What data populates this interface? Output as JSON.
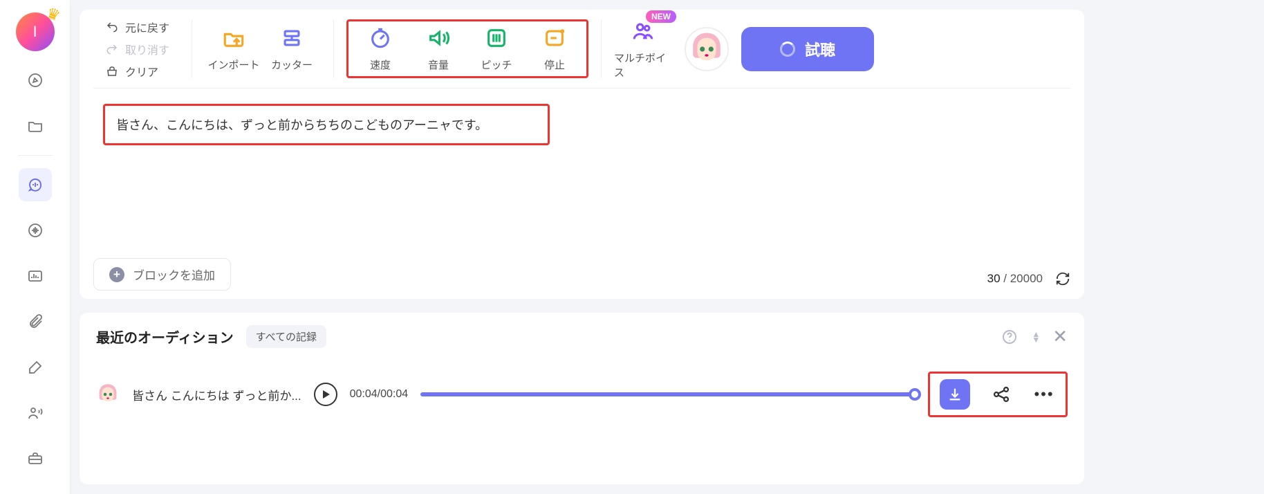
{
  "user": {
    "initial": "I"
  },
  "sidebar": {
    "activeIndex": 2
  },
  "toolbar": {
    "undo": "元に戻す",
    "redo": "取り消す",
    "clear": "クリア",
    "import": "インポート",
    "cutter": "カッター",
    "speed": "速度",
    "volume": "音量",
    "pitch": "ピッチ",
    "stop": "停止",
    "multivoice": "マルチボイス",
    "new_badge": "NEW",
    "listen": "試聴"
  },
  "editor": {
    "text": "皆さん、こんにちは、ずっと前からちちのこどものアーニャです。",
    "add_block": "ブロックを追加",
    "count_current": "30",
    "count_max": "20000"
  },
  "audition": {
    "title": "最近のオーディション",
    "tab_all": "すべての記録",
    "items": [
      {
        "text": "皆さん こんにちは ずっと前か...",
        "time_current": "00:04",
        "time_total": "00:04"
      }
    ]
  }
}
